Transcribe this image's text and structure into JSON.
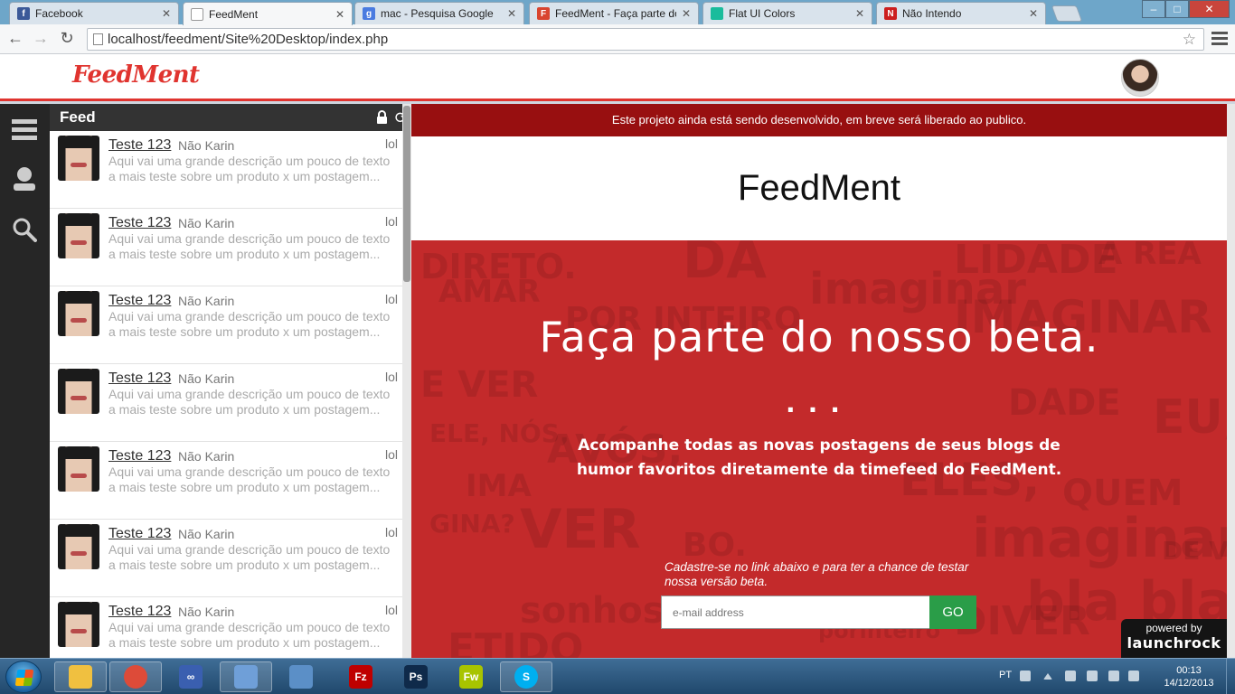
{
  "browser": {
    "tabs": [
      {
        "label": "Facebook",
        "icon": "facebook-icon",
        "color": "#3b5998",
        "glyph": "f",
        "active": false
      },
      {
        "label": "FeedMent",
        "icon": "page-icon",
        "color": "#ffffff",
        "glyph": "",
        "active": true
      },
      {
        "label": "mac - Pesquisa Google",
        "icon": "google-icon",
        "color": "#4a7be0",
        "glyph": "g",
        "active": false
      },
      {
        "label": "FeedMent - Faça parte do",
        "icon": "feedment-icon",
        "color": "#d9452f",
        "glyph": "F",
        "active": false
      },
      {
        "label": "Flat UI Colors",
        "icon": "flatui-icon",
        "color": "#1abc9c",
        "glyph": "",
        "active": false
      },
      {
        "label": "Não Intendo",
        "icon": "nao-intendo-icon",
        "color": "#cc1f1f",
        "glyph": "N",
        "active": false
      }
    ],
    "url": "localhost/feedment/Site%20Desktop/index.php"
  },
  "header": {
    "logo": "FeedMent"
  },
  "feed": {
    "title": "Feed",
    "items": [
      {
        "title": "Teste 123",
        "author": "Não Karin",
        "tag": "lol",
        "desc": "Aqui vai uma grande descrição um pouco de texto a mais teste sobre um produto x um postagem..."
      },
      {
        "title": "Teste 123",
        "author": "Não Karin",
        "tag": "lol",
        "desc": "Aqui vai uma grande descrição um pouco de texto a mais teste sobre um produto x um postagem..."
      },
      {
        "title": "Teste 123",
        "author": "Não Karin",
        "tag": "lol",
        "desc": "Aqui vai uma grande descrição um pouco de texto a mais teste sobre um produto x um postagem..."
      },
      {
        "title": "Teste 123",
        "author": "Não Karin",
        "tag": "lol",
        "desc": "Aqui vai uma grande descrição um pouco de texto a mais teste sobre um produto x um postagem..."
      },
      {
        "title": "Teste 123",
        "author": "Não Karin",
        "tag": "lol",
        "desc": "Aqui vai uma grande descrição um pouco de texto a mais teste sobre um produto x um postagem..."
      },
      {
        "title": "Teste 123",
        "author": "Não Karin",
        "tag": "lol",
        "desc": "Aqui vai uma grande descrição um pouco de texto a mais teste sobre um produto x um postagem..."
      },
      {
        "title": "Teste 123",
        "author": "Não Karin",
        "tag": "lol",
        "desc": "Aqui vai uma grande descrição um pouco de texto a mais teste sobre um produto x um postagem..."
      }
    ]
  },
  "main": {
    "notice": "Este projeto ainda está sendo desenvolvido, em breve será liberado ao publico.",
    "brand": "FeedMent",
    "hero_title": "Faça parte do nosso beta.",
    "hero_dots": "...",
    "hero_subtitle": "Acompanhe todas as novas postagens de seus blogs de humor favoritos diretamente da timefeed do FeedMent.",
    "signup_text": "Cadastre-se no link abaixo e para ter a chance de testar nossa versão beta.",
    "email_placeholder": "e-mail address",
    "go_label": "GO",
    "powered_by": "powered by",
    "powered_brand": "launchrock",
    "background_words": [
      "DIRETO.",
      "DA",
      "A REA",
      "LIDADE",
      "imaginar",
      "AMAR",
      "IMAGINAR",
      "POR INTEIRO",
      "E VER",
      "DADE",
      "EU, TU,",
      "ELE, NÓS,",
      "AVÓS,",
      "ELES,",
      "QUEM",
      "IMA",
      "GINA?",
      "VER",
      "BO.",
      "imaginarium",
      "DE VER",
      "bla bla",
      "sonhos",
      "porinteiro",
      "DIVER",
      "ETIDO"
    ]
  },
  "colors": {
    "accent": "#e0342f",
    "notice_bg": "#980f10",
    "hero_bg": "#c32a2b",
    "go_button": "#2a9d48"
  },
  "taskbar": {
    "apps": [
      {
        "name": "explorer",
        "icon": "folder-icon",
        "color": "#f0c040",
        "glyph": "",
        "pinned": true
      },
      {
        "name": "chrome",
        "icon": "chrome-icon",
        "color": "#dd4b39",
        "glyph": "",
        "pinned": true
      },
      {
        "name": "app-loop",
        "icon": "infinity-icon",
        "color": "#3a5fb0",
        "glyph": "∞",
        "pinned": false
      },
      {
        "name": "virtualbox",
        "icon": "cube-icon",
        "color": "#6f9fd8",
        "glyph": "",
        "pinned": true
      },
      {
        "name": "network",
        "icon": "network-icon",
        "color": "#5b8fc7",
        "glyph": "",
        "pinned": false
      },
      {
        "name": "filezilla",
        "icon": "filezilla-icon",
        "color": "#bf0000",
        "glyph": "Fz",
        "pinned": false
      },
      {
        "name": "photoshop",
        "icon": "photoshop-icon",
        "color": "#0f2a4a",
        "glyph": "Ps",
        "pinned": false
      },
      {
        "name": "fireworks",
        "icon": "fireworks-icon",
        "color": "#a8c400",
        "glyph": "Fw",
        "pinned": false
      },
      {
        "name": "skype",
        "icon": "skype-icon",
        "color": "#00aff0",
        "glyph": "S",
        "pinned": true
      }
    ],
    "language": "PT",
    "time": "00:13",
    "date": "14/12/2013"
  }
}
